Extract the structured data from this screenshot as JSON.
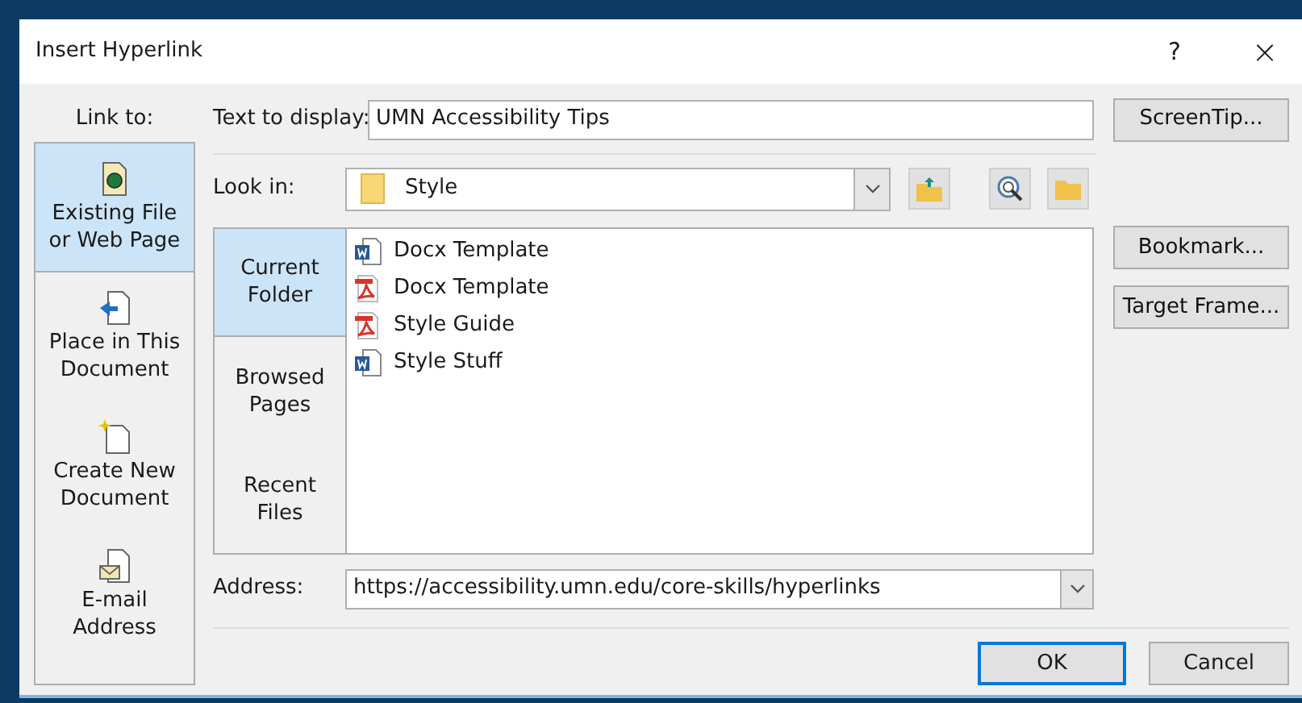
{
  "window": {
    "title": "Insert Hyperlink",
    "help": "?",
    "close": "×"
  },
  "link_to": {
    "label": "Link to:",
    "items": [
      {
        "label": "Existing File or Web Page",
        "kind": "file",
        "selected": true
      },
      {
        "label": "Place in This Document",
        "kind": "place",
        "selected": false
      },
      {
        "label": "Create New Document",
        "kind": "new",
        "selected": false
      },
      {
        "label": "E-mail Address",
        "kind": "email",
        "selected": false
      }
    ]
  },
  "text_to_display": {
    "label": "Text to display:",
    "value": "UMN Accessibility Tips"
  },
  "screentip_button": "ScreenTip...",
  "look_in": {
    "label": "Look in:",
    "value": "Style"
  },
  "view_tabs": [
    {
      "label": "Current Folder",
      "selected": true
    },
    {
      "label": "Browsed Pages",
      "selected": false
    },
    {
      "label": "Recent Files",
      "selected": false
    }
  ],
  "files": [
    {
      "name": "Docx Template",
      "kind": "word"
    },
    {
      "name": "Docx Template",
      "kind": "pdf"
    },
    {
      "name": "Style Guide",
      "kind": "pdf"
    },
    {
      "name": "Style Stuff",
      "kind": "word"
    }
  ],
  "side_buttons": [
    "Bookmark...",
    "Target Frame..."
  ],
  "address": {
    "label": "Address:",
    "value": "https://accessibility.umn.edu/core-skills/hyperlinks"
  },
  "buttons": [
    {
      "label": "OK",
      "default": true
    },
    {
      "label": "Cancel",
      "default": false
    }
  ]
}
